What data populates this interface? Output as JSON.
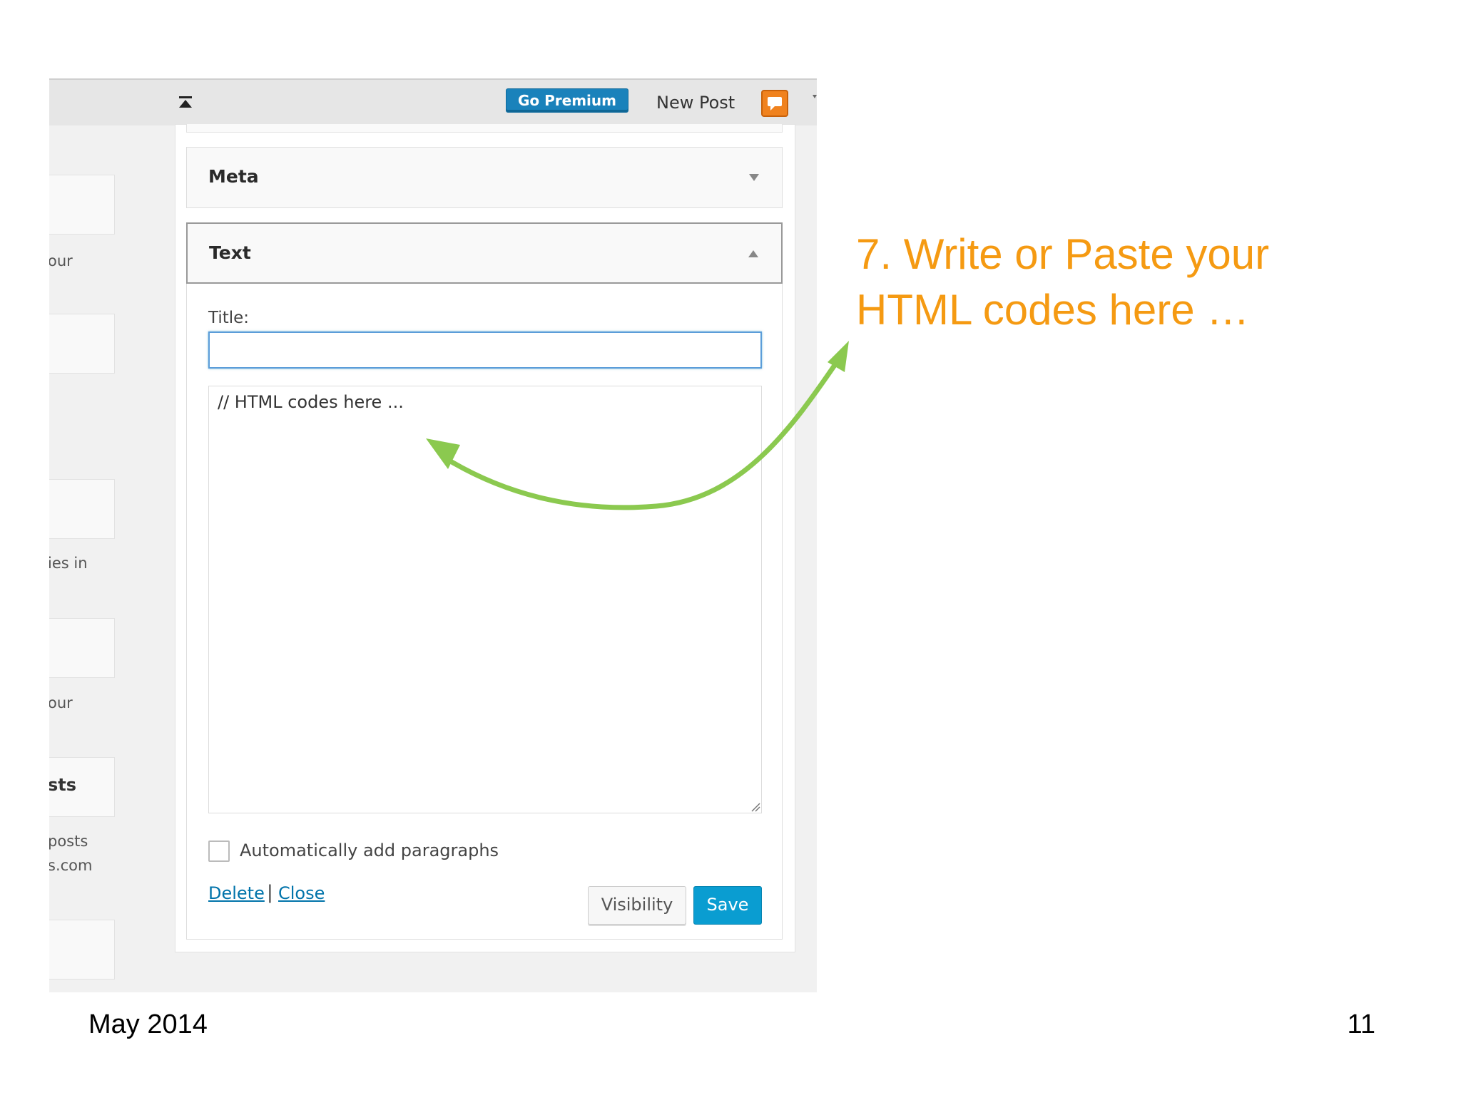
{
  "topbar": {
    "go_premium_label": "Go Premium",
    "new_post_label": "New Post",
    "icons": [
      "collapse-toolbar-icon",
      "notification-icon"
    ]
  },
  "sidebar_fragments": [
    "our",
    "ies in",
    "our",
    "sts",
    "posts",
    "s.com"
  ],
  "widgets": {
    "meta": {
      "title": "Meta",
      "toggle_icon": "arrow-down-icon"
    },
    "text": {
      "title": "Text",
      "toggle_icon": "arrow-up-icon",
      "title_label": "Title:",
      "title_value": "",
      "content_value": "// HTML codes here ...",
      "auto_paragraphs_label": "Automatically add paragraphs",
      "auto_paragraphs_checked": false,
      "delete_label": "Delete",
      "separator": "|",
      "close_label": "Close",
      "visibility_label": "Visibility",
      "save_label": "Save"
    }
  },
  "callout": {
    "line1": "7. Write or Paste your",
    "line2": "HTML codes here …",
    "color": "#f59a12"
  },
  "footer": {
    "date": "May 2014",
    "page_number": "11"
  },
  "colors": {
    "go_premium": "#1a82bb",
    "save_button": "#0a9dd1",
    "notification": "#f0821e",
    "pointer_arrow": "#8bc94f"
  }
}
